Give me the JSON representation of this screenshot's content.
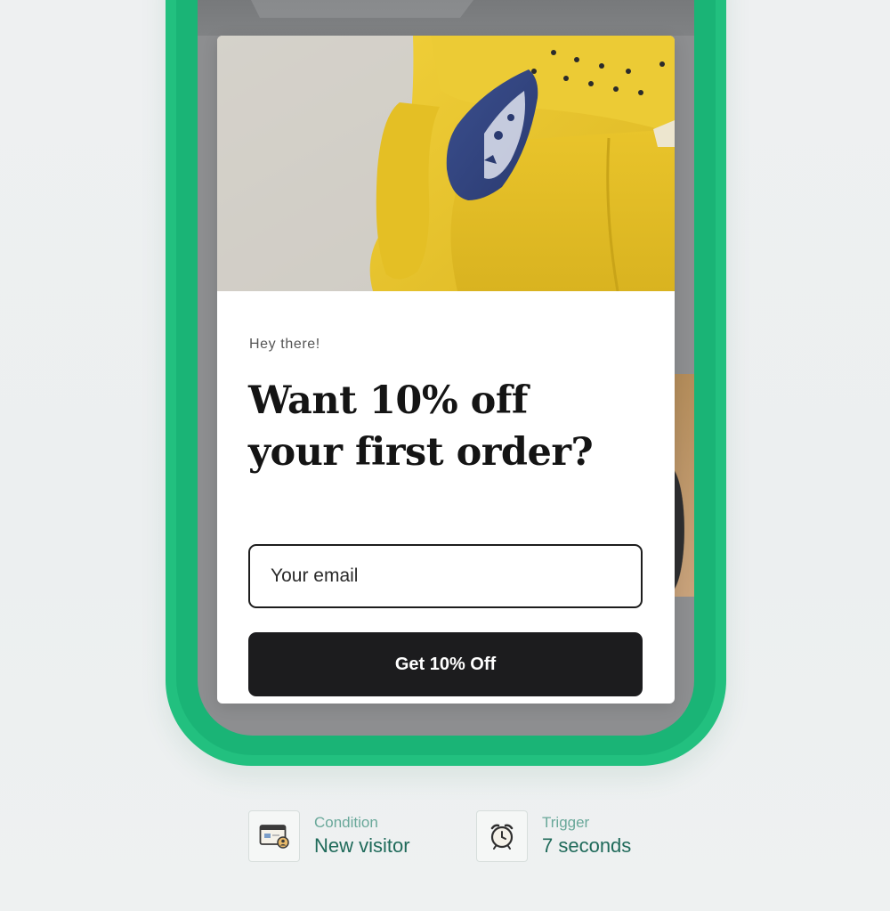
{
  "popup": {
    "eyebrow": "Hey there!",
    "headline_line1": "Want 10% off",
    "headline_line2": "your first order?",
    "email_placeholder": "Your email",
    "cta_label": "Get 10% Off"
  },
  "meta": {
    "condition": {
      "label": "Condition",
      "value": "New visitor",
      "icon": "browser-user-icon"
    },
    "trigger": {
      "label": "Trigger",
      "value": "7 seconds",
      "icon": "alarm-clock-icon"
    }
  },
  "colors": {
    "phone_frame": "#22c07f",
    "cta_background": "#1c1c1e",
    "meta_label": "#6aa89a",
    "meta_value": "#1f6a5a",
    "sofa": "#e9c62f"
  }
}
